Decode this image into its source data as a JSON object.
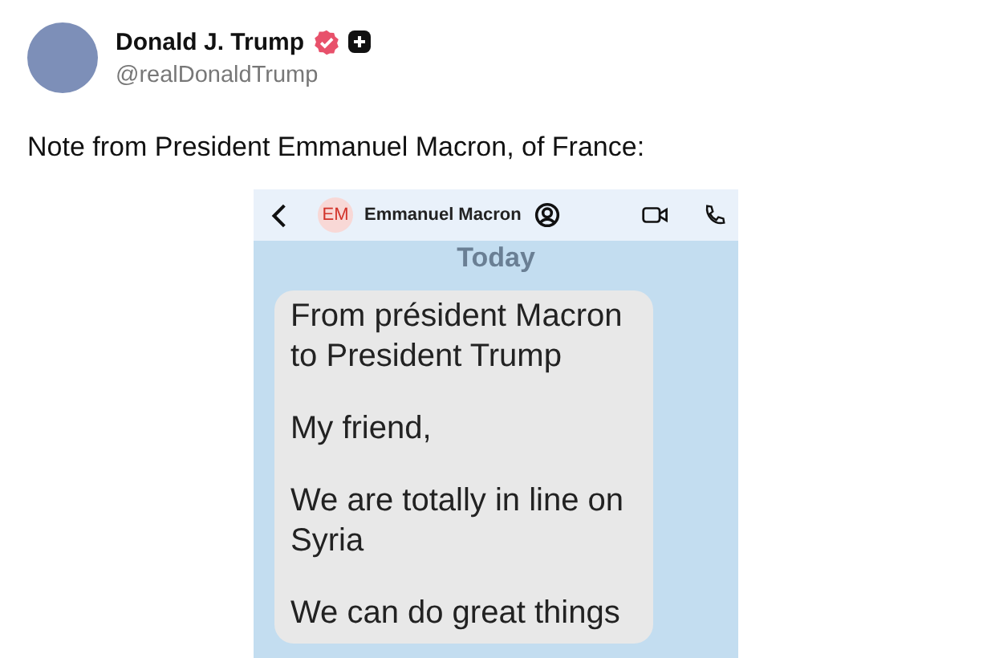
{
  "post": {
    "author": {
      "name": "Donald J. Trump",
      "handle": "@realDonaldTrump",
      "verified": true
    },
    "text": "Note from President Emmanuel Macron, of France:",
    "attachment": {
      "chat_header": {
        "initials": "EM",
        "contact": "Emmanuel Macron"
      },
      "day_label": "Today",
      "messages": [
        {
          "paragraphs": [
            "From président Macron to President Trump",
            "My friend,",
            "We are totally in line on Syria",
            "We can do great things"
          ]
        }
      ]
    }
  }
}
